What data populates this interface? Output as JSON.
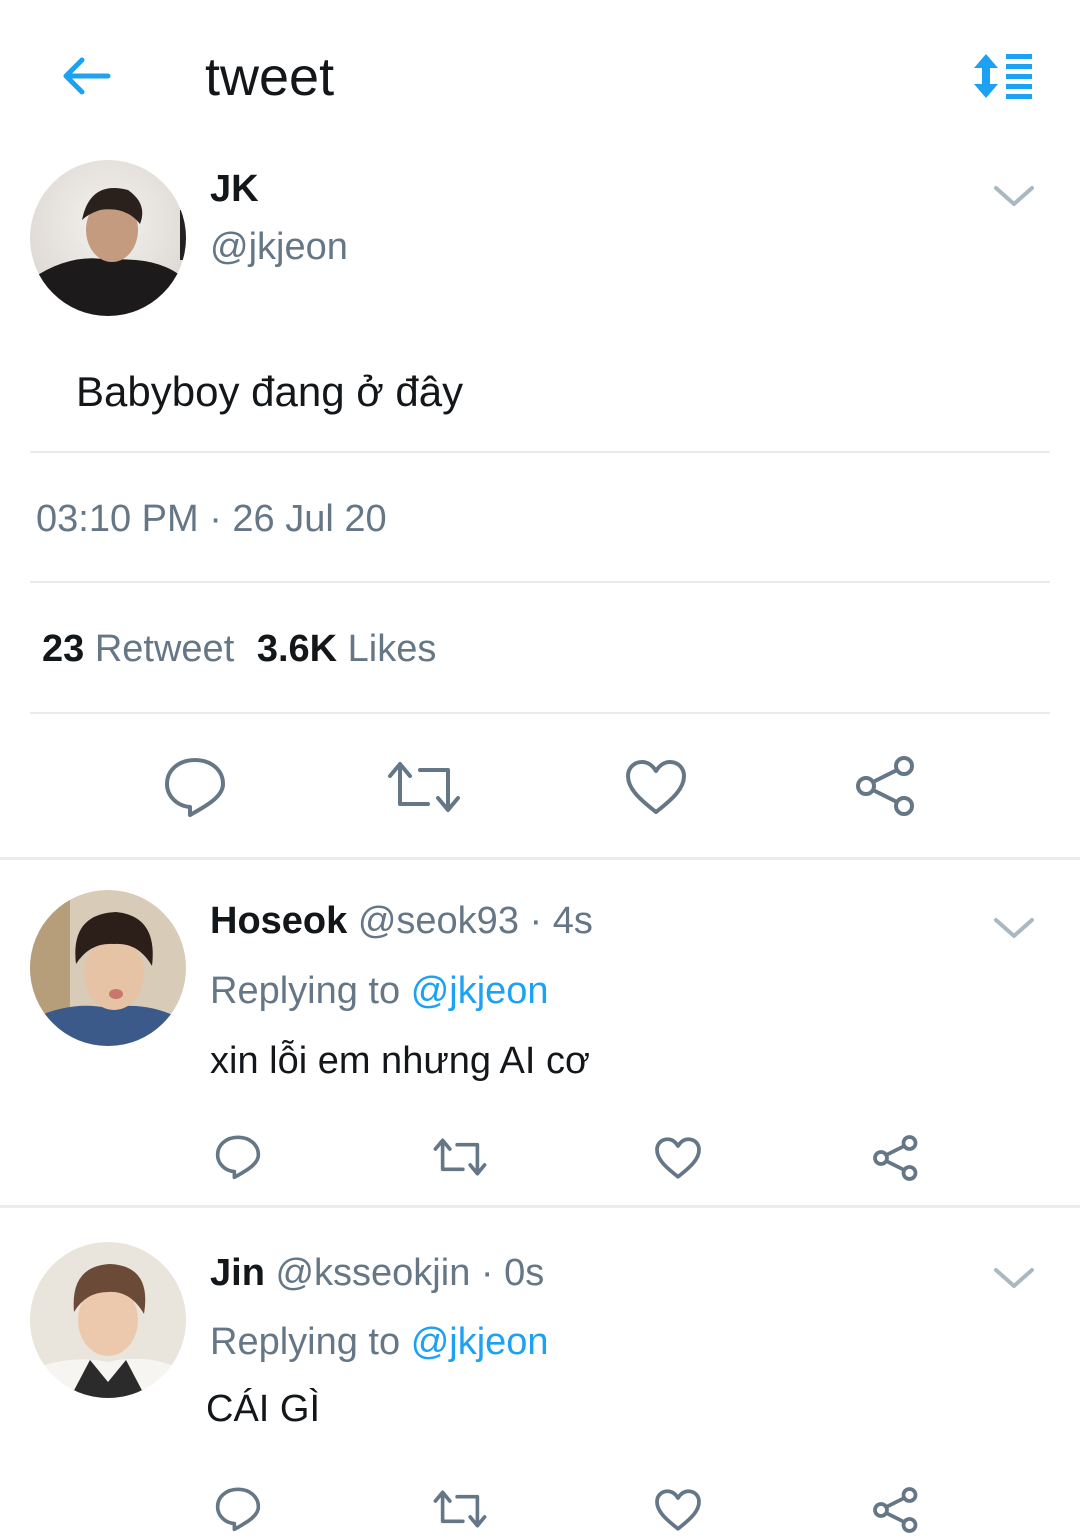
{
  "header": {
    "title": "tweet",
    "back_icon": "arrow-left-icon",
    "sort_icon": "sort-list-icon",
    "accent": "#1da1f2"
  },
  "tweet": {
    "author_name": "JK",
    "author_handle": "@jkjeon",
    "text": "Babyboy đang ở đây",
    "timestamp": "03:10 PM · 26 Jul 20",
    "retweet_count": "23",
    "retweet_label": "Retweet",
    "likes_count": "3.6K",
    "likes_label": "Likes"
  },
  "replies": [
    {
      "name": "Hoseok",
      "handle": "@seok93",
      "time": "· 4s",
      "replying_label": "Replying to",
      "replying_to": "@jkjeon",
      "text": "xin lỗi em nhưng AI cơ"
    },
    {
      "name": "Jin",
      "handle": "@ksseokjin",
      "time": "· 0s",
      "replying_label": "Replying to",
      "replying_to": "@jkjeon",
      "text": "CÁI GÌ"
    }
  ],
  "colors": {
    "text": "#14171a",
    "secondary": "#657786",
    "link": "#1da1f2",
    "divider": "#e6ecf0"
  }
}
